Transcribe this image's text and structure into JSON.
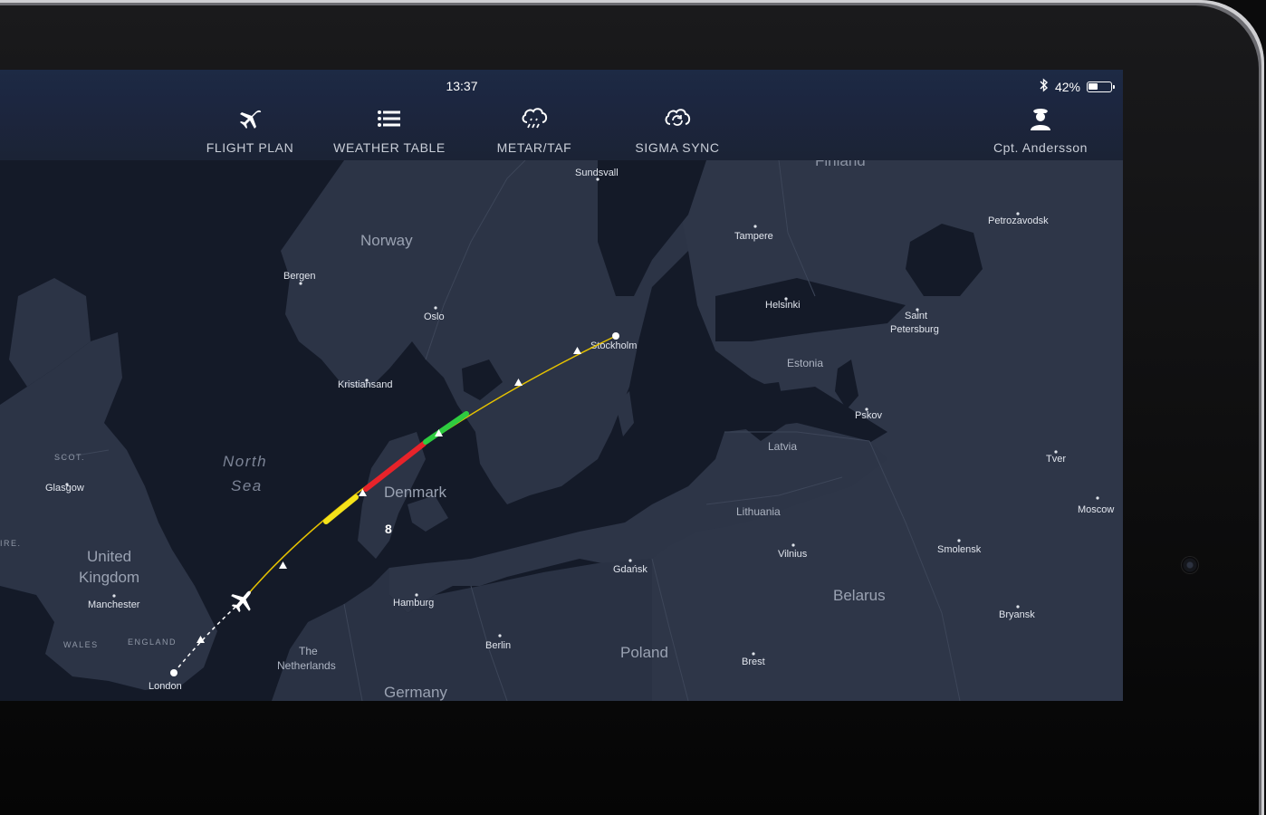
{
  "status": {
    "time": "13:37",
    "battery": "42%",
    "battery_level": 0.42,
    "bluetooth_icon": "bluetooth-icon"
  },
  "toolbar": {
    "flight_plan": {
      "label": "FLIGHT PLAN",
      "icon": "airplane-icon"
    },
    "weather_table": {
      "label": "WEATHER TABLE",
      "icon": "list-icon"
    },
    "metar_taf": {
      "label": "METAR/TAF",
      "icon": "cloud-rain-icon"
    },
    "sigma_sync": {
      "label": "SIGMA SYNC",
      "icon": "cloud-sync-icon"
    },
    "user": {
      "label": "Cpt. Andersson",
      "icon": "pilot-icon"
    }
  },
  "map": {
    "countries": {
      "finland": "Finland",
      "norway": "Norway",
      "denmark": "Denmark",
      "estonia": "Estonia",
      "latvia": "Latvia",
      "lithuania": "Lithuania",
      "belarus": "Belarus",
      "poland": "Poland",
      "germany": "Germany",
      "netherlands_1": "The",
      "netherlands_2": "Netherlands",
      "uk_1": "United",
      "uk_2": "Kingdom"
    },
    "regions": {
      "scotland": "SCOT.",
      "england": "ENGLAND",
      "wales": "WALES",
      "ire": "IRE."
    },
    "sea": {
      "line1": "North",
      "line2": "Sea"
    },
    "cities": {
      "sundsvall": "Sundsvall",
      "tampere": "Tampere",
      "petrozavodsk": "Petrozavodsk",
      "bergen": "Bergen",
      "oslo": "Oslo",
      "helsinki": "Helsinki",
      "saint_1": "Saint",
      "saint_2": "Petersburg",
      "stockholm": "Stockholm",
      "kristiansand": "Kristiansand",
      "pskov": "Pskov",
      "glasgow": "Glasgow",
      "tver": "Tver",
      "moscow": "Moscow",
      "gdansk": "Gdańsk",
      "vilnius": "Vilnius",
      "smolensk": "Smolensk",
      "manchester": "Manchester",
      "hamburg": "Hamburg",
      "bryansk": "Bryansk",
      "berlin": "Berlin",
      "brest": "Brest",
      "london": "London"
    },
    "route_marker": "8",
    "route": {
      "origin": "London",
      "destination": "Stockholm",
      "segment_colors": {
        "line": "#e6c200",
        "caution": "#f5e31a",
        "severe": "#e8232a",
        "good": "#2ecc40",
        "past": "#ffffff"
      }
    }
  }
}
